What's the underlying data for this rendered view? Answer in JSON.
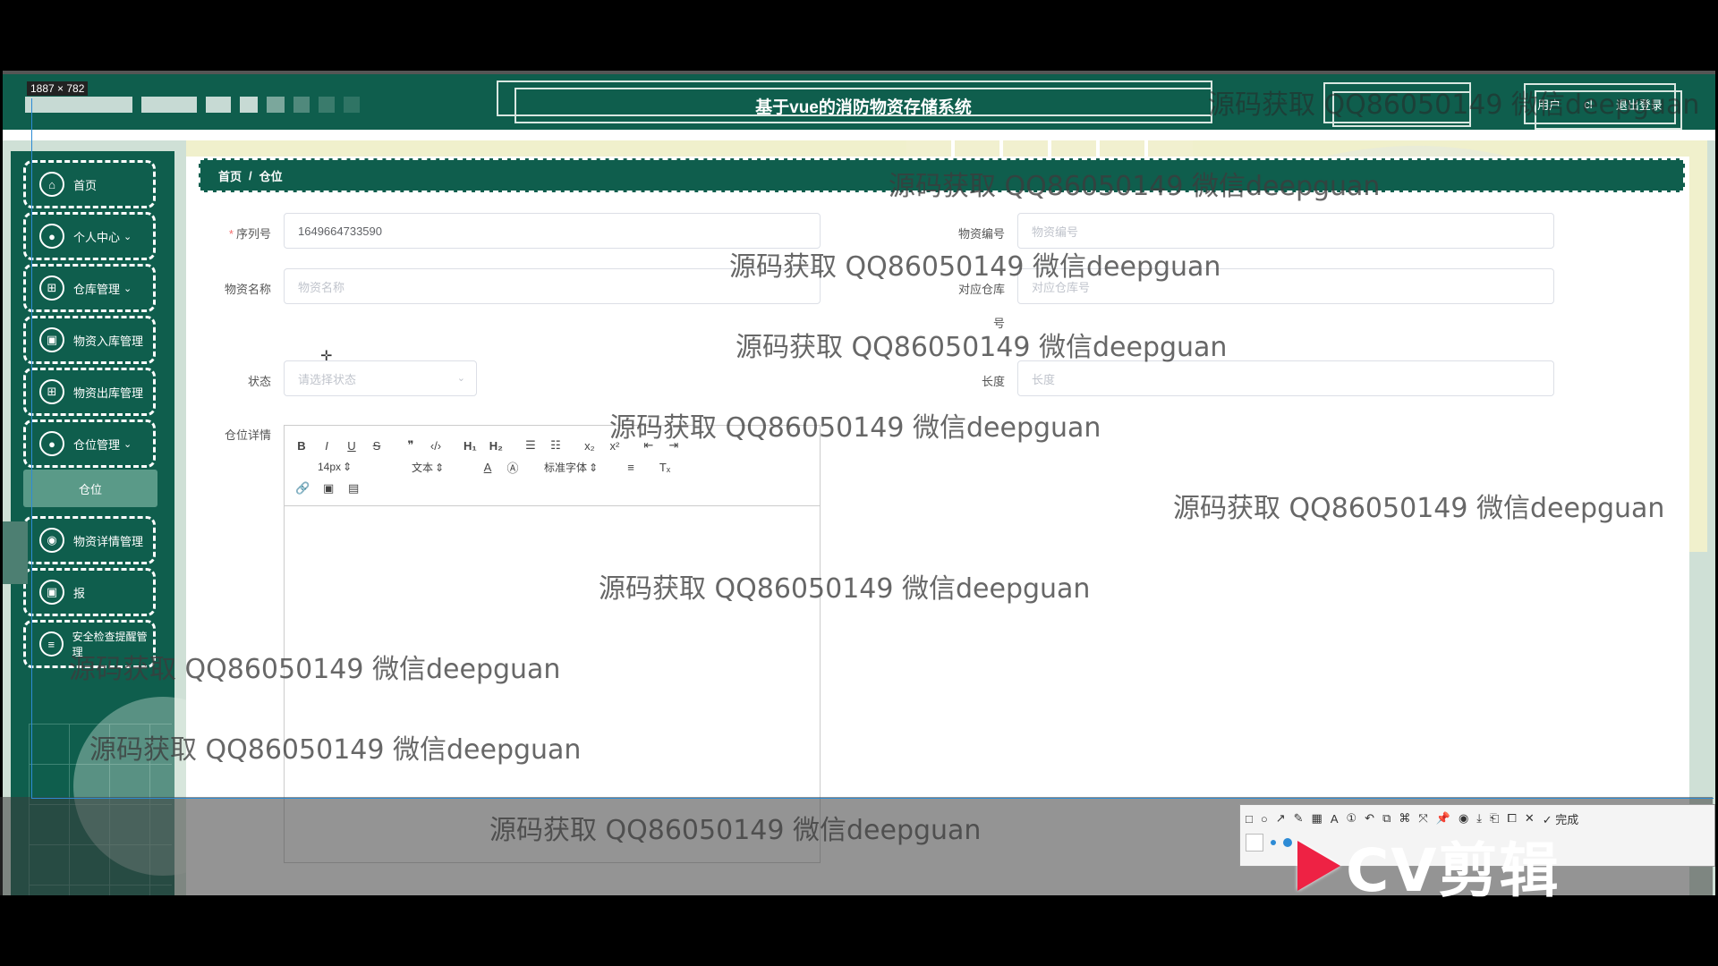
{
  "overlay": {
    "size_tag": "1887 × 782"
  },
  "header": {
    "title": "基于vue的消防物资存储系统",
    "user_label": "用户",
    "user_extra": "cl",
    "logout_label": "退出登录"
  },
  "sidebar": {
    "items": [
      {
        "label": "首页",
        "icon": "home-icon",
        "chevron": ""
      },
      {
        "label": "个人中心",
        "icon": "user-icon",
        "chevron": "⌄"
      },
      {
        "label": "仓库管理",
        "icon": "grid-icon",
        "chevron": "⌄"
      },
      {
        "label": "物资入库管理",
        "icon": "inbox-icon",
        "chevron": ""
      },
      {
        "label": "物资出库管理",
        "icon": "grid-icon",
        "chevron": ""
      },
      {
        "label": "仓位管理",
        "icon": "user-icon",
        "chevron": "⌄"
      },
      {
        "label": "物资详情管理",
        "icon": "circle-icon",
        "chevron": ""
      },
      {
        "label": "报",
        "icon": "inbox-icon",
        "chevron": ""
      },
      {
        "label": "安全检查提醒管理",
        "icon": "list-icon",
        "chevron": ""
      }
    ],
    "submenu": {
      "label": "仓位"
    }
  },
  "breadcrumb": {
    "home": "首页",
    "sep": "/",
    "current": "仓位"
  },
  "form": {
    "serial": {
      "label": "序列号",
      "value": "1649664733590"
    },
    "material_no": {
      "label": "物资编号",
      "placeholder": "物资编号"
    },
    "material_name": {
      "label": "物资名称",
      "placeholder": "物资名称"
    },
    "warehouse_no": {
      "label": "对应仓库",
      "label2": "号",
      "placeholder": "对应仓库号"
    },
    "status": {
      "label": "状态",
      "placeholder": "请选择状态"
    },
    "length": {
      "label": "长度",
      "placeholder": "长度"
    },
    "detail": {
      "label": "仓位详情"
    }
  },
  "editor": {
    "font_size": "14px",
    "header_type": "文本",
    "font_family": "标准字体"
  },
  "watermark": "源码获取 QQ86050149 微信deepguan",
  "cv_logo": "CV剪辑",
  "shot_toolbar": {
    "done_label": "完成"
  }
}
